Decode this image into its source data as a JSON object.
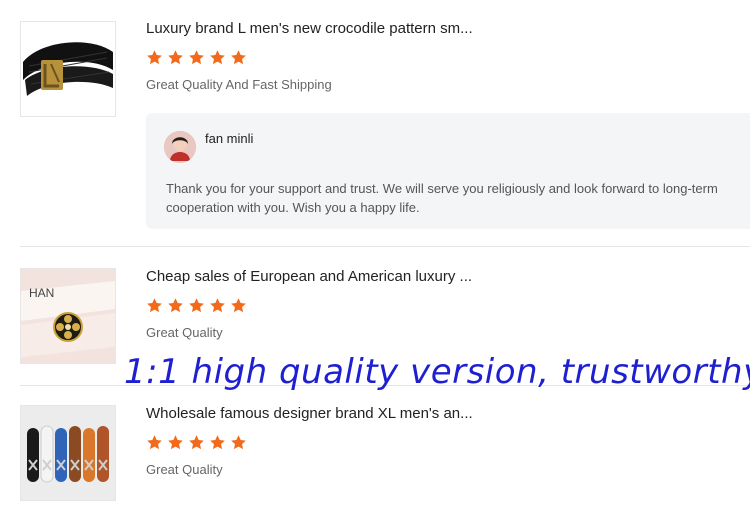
{
  "reviews": [
    {
      "title": "Luxury brand L men's new crocodile pattern sm...",
      "rating": 5,
      "comment": "Great Quality And Fast Shipping",
      "image_icon": "black-crocodile-belt-product-image",
      "reply": {
        "author": "fan minli",
        "text": "Thank you for your support and trust. We will serve you religiously and look forward to long-term cooperation with you. Wish you a happy life."
      }
    },
    {
      "title": "Cheap sales of European and American luxury ...",
      "rating": 5,
      "comment": "Great Quality",
      "image_icon": "white-flower-buckle-belt-product-image",
      "image_text": "HAN"
    },
    {
      "title": "Wholesale famous designer brand XL men's an...",
      "rating": 5,
      "comment": "Great Quality",
      "image_icon": "multicolor-belts-product-image"
    }
  ],
  "overlay_text": "1:1 high quality version, trustworthy!",
  "colors": {
    "star": "#f26a1b",
    "overlay": "#1f1fd2",
    "reply_bg": "#f4f5f7"
  }
}
